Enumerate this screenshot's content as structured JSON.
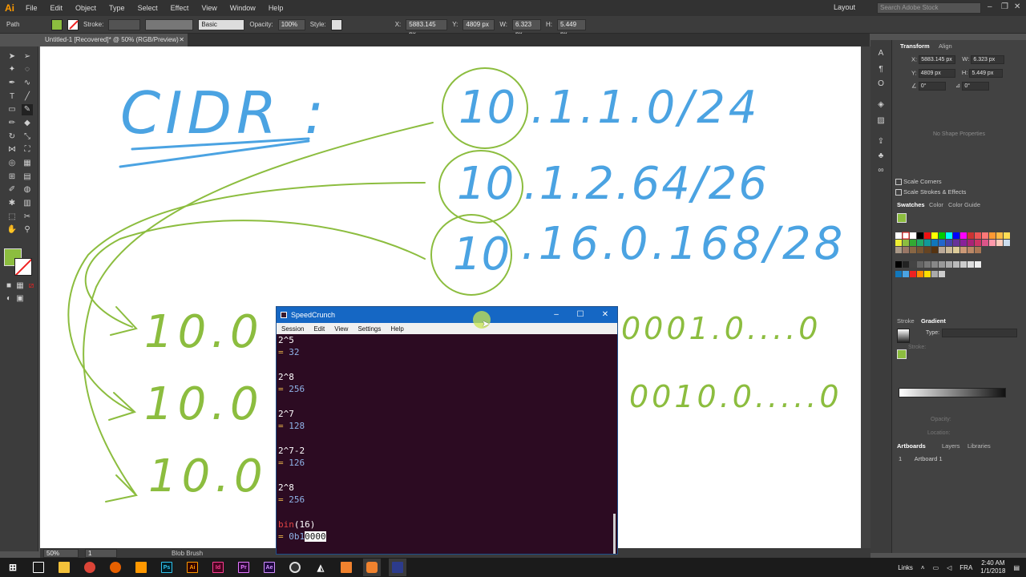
{
  "app": {
    "logo": "Ai"
  },
  "menu": [
    "File",
    "Edit",
    "Object",
    "Type",
    "Select",
    "Effect",
    "View",
    "Window",
    "Help"
  ],
  "workspace": {
    "layout_label": "Layout",
    "search_placeholder": "Search Adobe Stock"
  },
  "control": {
    "selection_type": "Path",
    "stroke_label": "Stroke:",
    "brush_label": "Basic",
    "opacity_label": "Opacity:",
    "opacity_value": "100%",
    "style_label": "Style:",
    "x_label": "X:",
    "x_value": "5883.145 px",
    "y_label": "Y:",
    "y_value": "4809 px",
    "w_label": "W:",
    "w_value": "6.323 px",
    "h_label": "H:",
    "h_value": "5.449 px"
  },
  "document": {
    "tab_label": "Untitled-1 [Recovered]* @ 50% (RGB/Preview)"
  },
  "status": {
    "zoom": "50%",
    "artboard_num": "1",
    "tool_name": "Blob Brush"
  },
  "transform_panel": {
    "tabs": [
      "Transform",
      "Align"
    ],
    "x_label": "X:",
    "x_value": "5883.145 px",
    "y_label": "Y:",
    "y_value": "4809 px",
    "w_label": "W:",
    "w_value": "6.323 px",
    "h_label": "H:",
    "h_value": "5.449 px",
    "angle_value": "0°",
    "shear_value": "0°",
    "no_shape": "No Shape Properties",
    "scale_corners": "Scale Corners",
    "scale_strokes": "Scale Strokes & Effects"
  },
  "swatches_panel": {
    "tabs": [
      "Swatches",
      "Color",
      "Color Guide"
    ]
  },
  "gradient_panel": {
    "tabs": [
      "Stroke",
      "Gradient"
    ],
    "type_label": "Type:",
    "stroke_label": "Stroke:",
    "opacity_label": "Opacity:",
    "location_label": "Location:"
  },
  "artboards_panel": {
    "tabs": [
      "Artboards",
      "Layers",
      "Libraries"
    ],
    "rows": [
      {
        "num": "1",
        "name": "Artboard 1"
      }
    ]
  },
  "speedcrunch": {
    "title": "SpeedCrunch",
    "menu": [
      "Session",
      "Edit",
      "View",
      "Settings",
      "Help"
    ],
    "entries": [
      {
        "expr": "2^5",
        "result": "32"
      },
      {
        "expr": "2^8",
        "result": "256"
      },
      {
        "expr": "2^7",
        "result": "128"
      },
      {
        "expr": "2^7-2",
        "result": "126"
      },
      {
        "expr": "2^8",
        "result": "256"
      }
    ],
    "last": {
      "fn": "bin",
      "arg_open": "(",
      "arg": "16",
      "arg_close": ")",
      "eq": "=",
      "result_prefix": "0b1",
      "result_selected": "0000"
    }
  },
  "canvas": {
    "heading": "CIDR :",
    "addresses": [
      {
        "first": "10",
        "rest": ".1.1.0/24"
      },
      {
        "first": "10",
        "rest": ".1.2.64/26"
      },
      {
        "first": "10",
        "rest": ".16.0.168/28"
      }
    ],
    "binary_left": [
      "10.0",
      "10.0",
      "10.0"
    ],
    "binary_right": [
      "0001.0....0",
      "0010.0.....0"
    ]
  },
  "taskbar": {
    "lang": "FRA",
    "links_label": "Links",
    "time": "2:40 AM",
    "date": "1/1/2018"
  },
  "colors": {
    "ink_blue": "#4ba3e2",
    "ink_green": "#8cbd3f",
    "sc_bg": "#2c0b22",
    "sc_title": "#1567c4"
  }
}
